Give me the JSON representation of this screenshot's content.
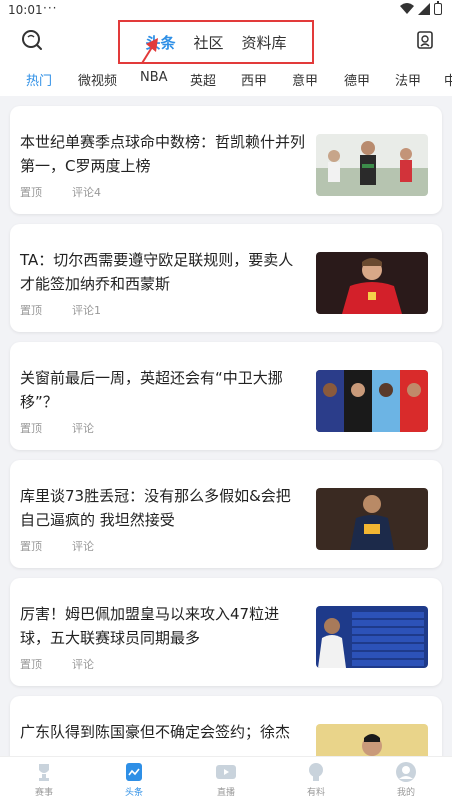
{
  "status": {
    "time": "10:01",
    "dots": "···"
  },
  "header": {
    "tabs": [
      {
        "label": "头条",
        "active": true
      },
      {
        "label": "社区",
        "active": false
      },
      {
        "label": "资料库",
        "active": false
      }
    ],
    "highlight_color": "#e23a3a",
    "accent_color": "#2e8fe6"
  },
  "categories": [
    "热门",
    "微视频",
    "NBA",
    "英超",
    "西甲",
    "意甲",
    "德甲",
    "法甲",
    "中"
  ],
  "articles": [
    {
      "title": "本世纪单赛季点球命中数榜：哲凯赖什并列第一，C罗两度上榜",
      "tag": "置顶",
      "comments": "评论4"
    },
    {
      "title": "TA：切尔西需要遵守欧足联规则，要卖人才能签加纳乔和西蒙斯",
      "tag": "置顶",
      "comments": "评论1"
    },
    {
      "title": "关窗前最后一周，英超还会有“中卫大挪移”？",
      "tag": "置顶",
      "comments": "评论"
    },
    {
      "title": "库里谈73胜丢冠：没有那么多假如&会把自己逼疯的 我坦然接受",
      "tag": "置顶",
      "comments": "评论"
    },
    {
      "title": "厉害！姆巴佩加盟皇马以来攻入47粒进球，五大联赛球员同期最多",
      "tag": "置顶",
      "comments": "评论"
    },
    {
      "title": "广东队得到陈国豪但不确定会签约；徐杰",
      "tag": "",
      "comments": ""
    }
  ],
  "bottom_nav": [
    {
      "label": "赛事",
      "icon": "trophy-icon",
      "active": false
    },
    {
      "label": "头条",
      "icon": "news-icon",
      "active": true
    },
    {
      "label": "直播",
      "icon": "video-icon",
      "active": false
    },
    {
      "label": "有料",
      "icon": "bulb-icon",
      "active": false
    },
    {
      "label": "我的",
      "icon": "profile-icon",
      "active": false
    }
  ]
}
